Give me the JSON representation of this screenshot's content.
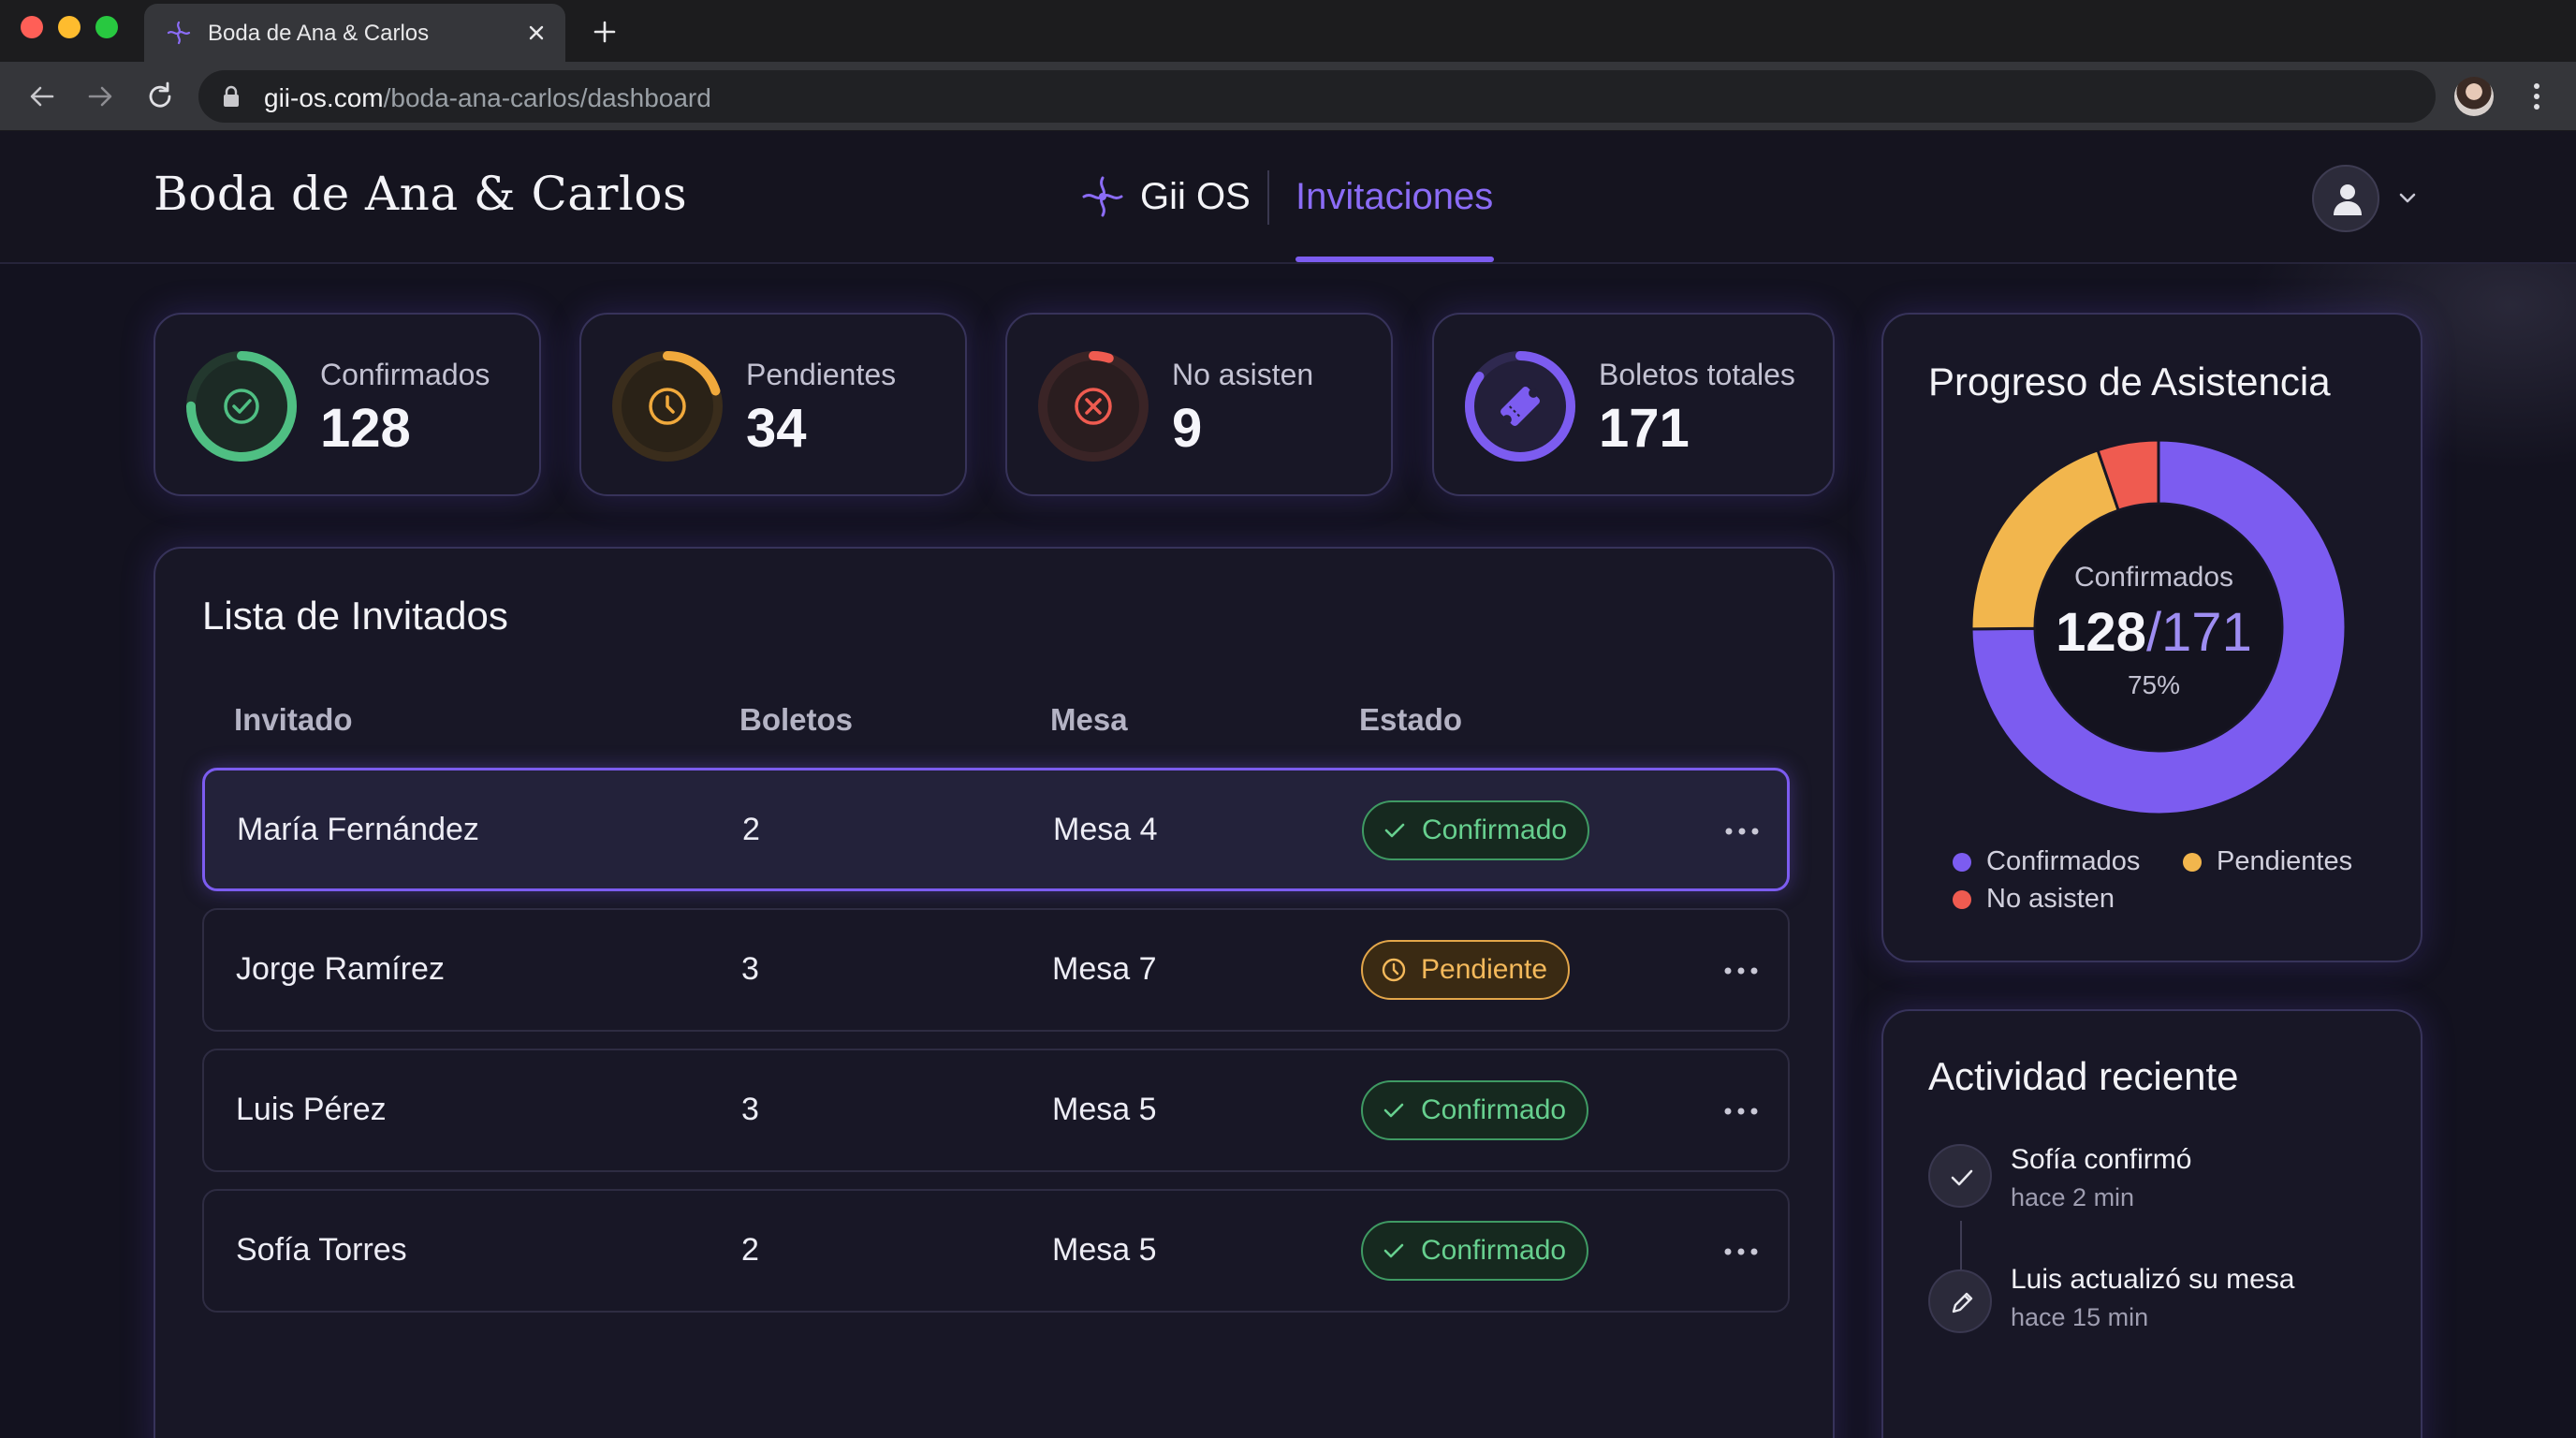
{
  "browser": {
    "tab_title": "Boda de Ana & Carlos",
    "url_host": "gii-os.com",
    "url_path": "/boda-ana-carlos/dashboard"
  },
  "header": {
    "title": "Boda de Ana & Carlos",
    "brand": "Gii OS",
    "active_tab": "Invitaciones"
  },
  "stats": [
    {
      "label": "Confirmados",
      "value": "128",
      "color": "#4fbf83",
      "fraction": 0.75,
      "icon": "check-icon"
    },
    {
      "label": "Pendientes",
      "value": "34",
      "color": "#f0a93c",
      "fraction": 0.2,
      "icon": "clock-icon"
    },
    {
      "label": "No asisten",
      "value": "9",
      "color": "#ef5b50",
      "fraction": 0.05,
      "icon": "x-icon"
    },
    {
      "label": "Boletos totales",
      "value": "171",
      "color": "#7c5cf0",
      "fraction": 0.85,
      "icon": "ticket-icon"
    }
  ],
  "guests": {
    "title": "Lista de Invitados",
    "columns": [
      "Invitado",
      "Boletos",
      "Mesa",
      "Estado"
    ],
    "rows": [
      {
        "name": "María Fernández",
        "tickets": "2",
        "table": "Mesa 4",
        "status": "Confirmado",
        "status_type": "ok"
      },
      {
        "name": "Jorge Ramírez",
        "tickets": "3",
        "table": "Mesa 7",
        "status": "Pendiente",
        "status_type": "pending"
      },
      {
        "name": "Luis Pérez",
        "tickets": "3",
        "table": "Mesa 5",
        "status": "Confirmado",
        "status_type": "ok"
      },
      {
        "name": "Sofía Torres",
        "tickets": "2",
        "table": "Mesa 5",
        "status": "Confirmado",
        "status_type": "ok"
      }
    ]
  },
  "progress": {
    "title": "Progreso de Asistencia",
    "center_label": "Confirmados",
    "confirmed": "128",
    "total": "/171",
    "percent": "75%",
    "legend": [
      {
        "label": "Confirmados",
        "color": "#7c5cf0"
      },
      {
        "label": "Pendientes",
        "color": "#f2b64d"
      },
      {
        "label": "No asisten",
        "color": "#ef5b50"
      }
    ]
  },
  "chart_data": {
    "type": "pie",
    "categories": [
      "Confirmados",
      "Pendientes",
      "No asisten"
    ],
    "values": [
      128,
      34,
      9
    ],
    "colors": [
      "#7c5cf0",
      "#f2b64d",
      "#ef5b50"
    ],
    "title": "Progreso de Asistencia",
    "legend_position": "bottom"
  },
  "activity": {
    "title": "Actividad reciente",
    "items": [
      {
        "text": "Sofía confirmó",
        "time": "hace 2 min",
        "icon": "check-icon"
      },
      {
        "text": "Luis actualizó su mesa",
        "time": "hace 15 min",
        "icon": "pencil-icon"
      }
    ]
  }
}
